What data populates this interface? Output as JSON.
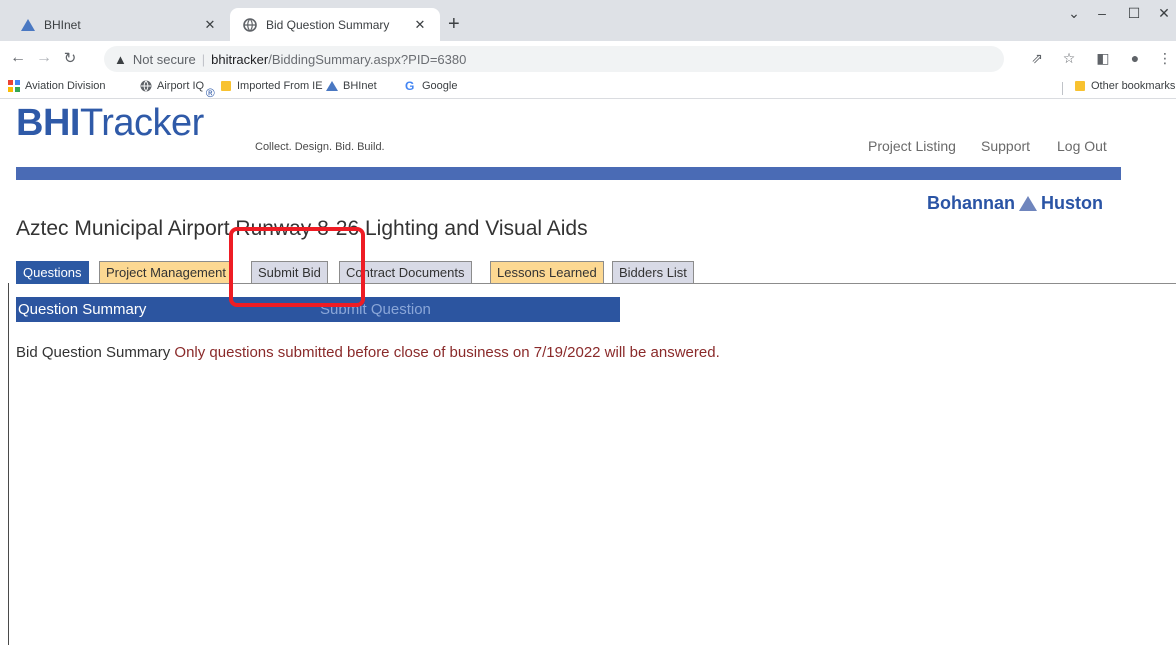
{
  "browser": {
    "tabs": [
      {
        "title": "BHInet",
        "active": false
      },
      {
        "title": "Bid Question Summary",
        "active": true
      }
    ],
    "address": {
      "security_label": "Not secure",
      "host": "bhitracker",
      "path": "/BiddingSummary.aspx?PID=6380"
    },
    "bookmarks": [
      "Aviation Division",
      "Airport IQ",
      "Imported From IE",
      "BHInet",
      "Google"
    ],
    "other_bookmarks": "Other bookmarks"
  },
  "site": {
    "logo_bold": "BHI",
    "logo_rest": "Tracker",
    "logo_mark": "®",
    "tagline": "Collect.  Design.  Bid.  Build.",
    "nav": [
      "Project Listing",
      "Support",
      "Log Out"
    ],
    "company_left": "Bohannan",
    "company_right": "Huston"
  },
  "project": {
    "title": "Aztec Municipal Airport Runway 8-26 Lighting and Visual Aids"
  },
  "page_tabs": [
    {
      "label": "Questions",
      "style": "active"
    },
    {
      "label": "Project Management",
      "style": "orange"
    },
    {
      "label": "Submit Bid",
      "style": "grey"
    },
    {
      "label": "Contract Documents",
      "style": "grey"
    },
    {
      "label": "Lessons Learned",
      "style": "orange"
    },
    {
      "label": "Bidders List",
      "style": "grey"
    }
  ],
  "summary": {
    "bar_label": "Question Summary",
    "submit_link": "Submit Question",
    "lead": "Bid Question Summary",
    "note": "Only questions submitted before close of business on 7/19/2022 will be answered."
  },
  "colors": {
    "accent": "#2c59a3",
    "tab_orange": "#fcd892",
    "tab_grey": "#d8dae6",
    "note_text": "#8a2a2a",
    "highlight": "#ee1c24"
  }
}
